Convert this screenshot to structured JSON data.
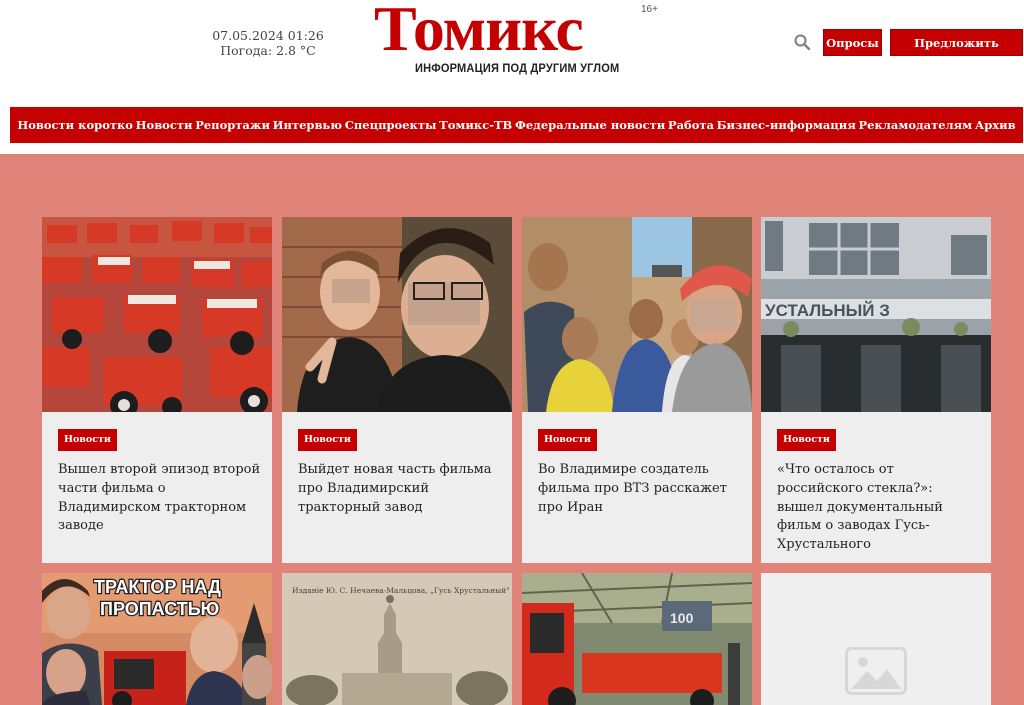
{
  "header": {
    "datetime": "07.05.2024 01:26",
    "weather": "Погода: 2.8 °C",
    "logo_title": "Томикс",
    "logo_age": "16+",
    "logo_tagline": "ИНФОРМАЦИЯ ПОД ДРУГИМ УГЛОМ",
    "polls_button": "Опросы",
    "suggest_news_button": "Предложить новость"
  },
  "nav": {
    "items": [
      "Новости коротко",
      "Новости",
      "Репортажи",
      "Интервью",
      "Спецпроекты",
      "Томикс-ТВ",
      "Федеральные новости",
      "Работа",
      "Бизнес-информация",
      "Рекламодателям",
      "Архив"
    ]
  },
  "cards": [
    {
      "category": "Новости",
      "title": "Вышел второй эпизод второй части фильма о Владимирском тракторном заводе"
    },
    {
      "category": "Новости",
      "title": "Выйдет новая часть фильма про Владимирский тракторный завод"
    },
    {
      "category": "Новости",
      "title": "Во Владимире создатель фильма про ВТЗ расскажет про Иран"
    },
    {
      "category": "Новости",
      "title": "«Что осталось от российского стекла?»: вышел документальный фильм о заводах Гусь-Хрустального"
    }
  ],
  "second_row": {
    "poster_text": "ТРАКТОР НАД ПРОПАСТЬЮ",
    "postcard_caption": "Изданіе Ю. С. Нечаева-Мальцова, Гусь Хрустальный.",
    "tractor_number": "100"
  },
  "colors": {
    "brand_red": "#c40000",
    "band_pink": "#e08378",
    "card_bg": "#eeeeee"
  }
}
